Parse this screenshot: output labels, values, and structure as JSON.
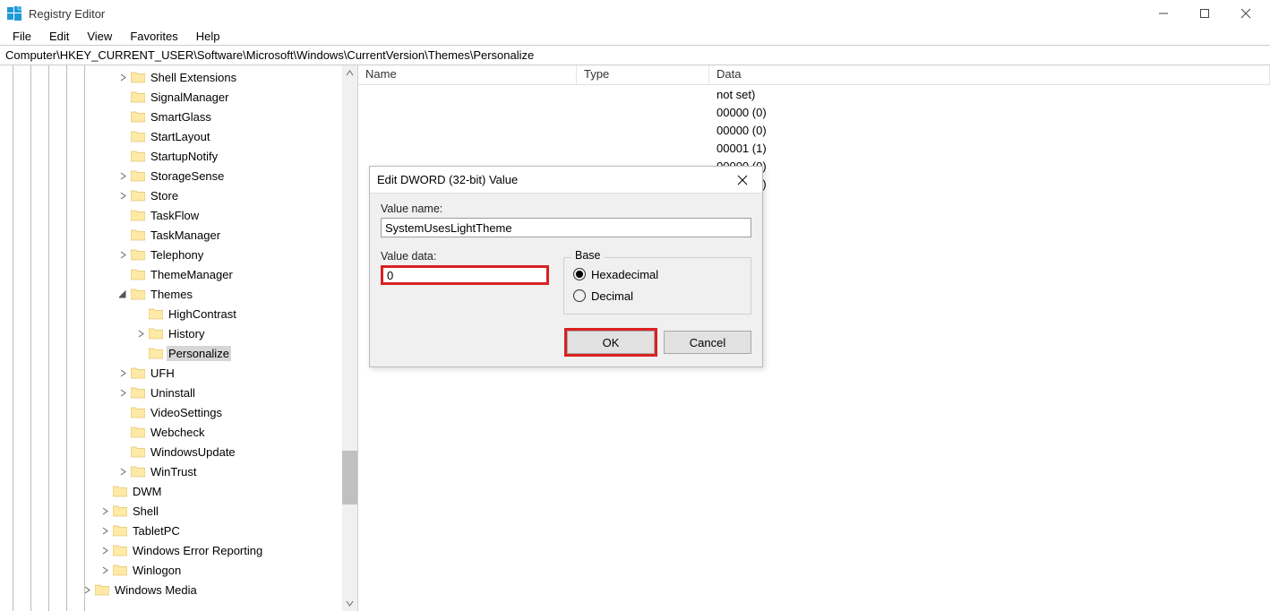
{
  "window": {
    "title": "Registry Editor"
  },
  "menu": {
    "file": "File",
    "edit": "Edit",
    "view": "View",
    "favorites": "Favorites",
    "help": "Help"
  },
  "address": "Computer\\HKEY_CURRENT_USER\\Software\\Microsoft\\Windows\\CurrentVersion\\Themes\\Personalize",
  "tree": {
    "items": [
      {
        "label": "Shell Extensions",
        "indent": 130,
        "expander": "closed"
      },
      {
        "label": "SignalManager",
        "indent": 130,
        "expander": "none"
      },
      {
        "label": "SmartGlass",
        "indent": 130,
        "expander": "none"
      },
      {
        "label": "StartLayout",
        "indent": 130,
        "expander": "none"
      },
      {
        "label": "StartupNotify",
        "indent": 130,
        "expander": "none"
      },
      {
        "label": "StorageSense",
        "indent": 130,
        "expander": "closed"
      },
      {
        "label": "Store",
        "indent": 130,
        "expander": "closed"
      },
      {
        "label": "TaskFlow",
        "indent": 130,
        "expander": "none"
      },
      {
        "label": "TaskManager",
        "indent": 130,
        "expander": "none"
      },
      {
        "label": "Telephony",
        "indent": 130,
        "expander": "closed"
      },
      {
        "label": "ThemeManager",
        "indent": 130,
        "expander": "none"
      },
      {
        "label": "Themes",
        "indent": 130,
        "expander": "open"
      },
      {
        "label": "HighContrast",
        "indent": 150,
        "expander": "none"
      },
      {
        "label": "History",
        "indent": 150,
        "expander": "closed"
      },
      {
        "label": "Personalize",
        "indent": 150,
        "expander": "none",
        "selected": true
      },
      {
        "label": "UFH",
        "indent": 130,
        "expander": "closed"
      },
      {
        "label": "Uninstall",
        "indent": 130,
        "expander": "closed"
      },
      {
        "label": "VideoSettings",
        "indent": 130,
        "expander": "none"
      },
      {
        "label": "Webcheck",
        "indent": 130,
        "expander": "none"
      },
      {
        "label": "WindowsUpdate",
        "indent": 130,
        "expander": "none"
      },
      {
        "label": "WinTrust",
        "indent": 130,
        "expander": "closed"
      },
      {
        "label": "DWM",
        "indent": 110,
        "expander": "none"
      },
      {
        "label": "Shell",
        "indent": 110,
        "expander": "closed"
      },
      {
        "label": "TabletPC",
        "indent": 110,
        "expander": "closed"
      },
      {
        "label": "Windows Error Reporting",
        "indent": 110,
        "expander": "closed"
      },
      {
        "label": "Winlogon",
        "indent": 110,
        "expander": "closed"
      },
      {
        "label": "Windows Media",
        "indent": 90,
        "expander": "closed"
      }
    ],
    "guides": [
      14,
      34,
      54,
      74,
      94
    ]
  },
  "list": {
    "columns": {
      "name": "Name",
      "type": "Type",
      "data": "Data"
    },
    "rows": [
      {
        "data_suffix": "not set)"
      },
      {
        "data_suffix": "00000 (0)"
      },
      {
        "data_suffix": "00000 (0)"
      },
      {
        "data_suffix": "00001 (1)"
      },
      {
        "data_suffix": "00000 (0)"
      },
      {
        "data_suffix": "00000 (0)"
      }
    ]
  },
  "dialog": {
    "title": "Edit DWORD (32-bit) Value",
    "value_name_label": "Value name:",
    "value_name": "SystemUsesLightTheme",
    "value_data_label": "Value data:",
    "value_data": "0",
    "base_label": "Base",
    "hex_label": "Hexadecimal",
    "dec_label": "Decimal",
    "base_selected": "hex",
    "ok": "OK",
    "cancel": "Cancel"
  }
}
